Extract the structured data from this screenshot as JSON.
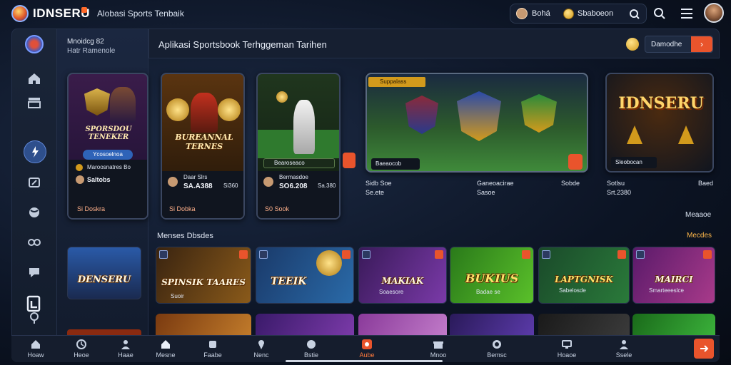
{
  "header": {
    "brand": "IDNSERU",
    "subtitle": "Alobasi Sports Tenbaik",
    "user_name": "Bohá",
    "balance": "Sbaboeon"
  },
  "sidebar": {
    "title1": "Mnoidcg 82",
    "title2": "Hatr Ramenole"
  },
  "main": {
    "title": "Aplikasi Sportsbook Terhggeman Tarihen",
    "action_label": "Damodhe",
    "action_arrow": "›"
  },
  "featured": [
    {
      "title": "SPORSDOU TENEKER",
      "button": "Ycosoelnoa",
      "line1": "Maroosnatres Bo",
      "line2": "Saltobs",
      "odd": "Si Doskra"
    },
    {
      "title": "BUREANNAL TERNES",
      "line1": "Daar Slrs",
      "line2": "SA.A388",
      "extra": "Si360",
      "odd": "Si Dobka"
    },
    {
      "title": "",
      "tag": "Bearoseaco",
      "line1": "Bermasdoe",
      "line2": "SO6.208",
      "extra": "Sa.380",
      "odd": "S0 Sook"
    },
    {
      "title": "",
      "tag": "Suppalass",
      "tag2": "Baeaocob",
      "line1": "Sidb Soe",
      "line2": "Se.ete",
      "extra": "Ganeoacirae",
      "extra2": "Sasoe",
      "extra3": "Sobde"
    },
    {
      "title": "IDNSERU",
      "tag": "Sleobocan",
      "line1": "Sotlsu",
      "line2": "Srt.2380",
      "extra": "Baed"
    }
  ],
  "section": {
    "label": "Menses Dbsdes",
    "view_all_top": "Meaaoe",
    "view_all": "Mecdes"
  },
  "side_tile": {
    "title": "DENSERU"
  },
  "tiles": [
    {
      "title": "SPINSIK TAARES",
      "sub": "Suoir"
    },
    {
      "title": "TEEIK",
      "sub": ""
    },
    {
      "title": "MAKIAK",
      "sub": "Soaesore"
    },
    {
      "title": "BUKIUS",
      "sub": "Badae se"
    },
    {
      "title": "LAPTGNISK",
      "sub": "Sabelosde"
    },
    {
      "title": "MAIRCI",
      "sub": "Smarteeeslce"
    }
  ],
  "bottom_nav": [
    {
      "label": "Hoaw"
    },
    {
      "label": "Heoe"
    },
    {
      "label": "Haae"
    },
    {
      "label": "Mesne"
    },
    {
      "label": "Faabe"
    },
    {
      "label": "Nenc"
    },
    {
      "label": "Bstie"
    },
    {
      "label": "Aube"
    },
    {
      "label": "Mnoo"
    },
    {
      "label": "Bemsc"
    },
    {
      "label": "Hoaoe"
    },
    {
      "label": "Ssele"
    }
  ],
  "colors": {
    "accent": "#e9542c",
    "panel": "#161f31",
    "active": "#2e4f8c"
  }
}
